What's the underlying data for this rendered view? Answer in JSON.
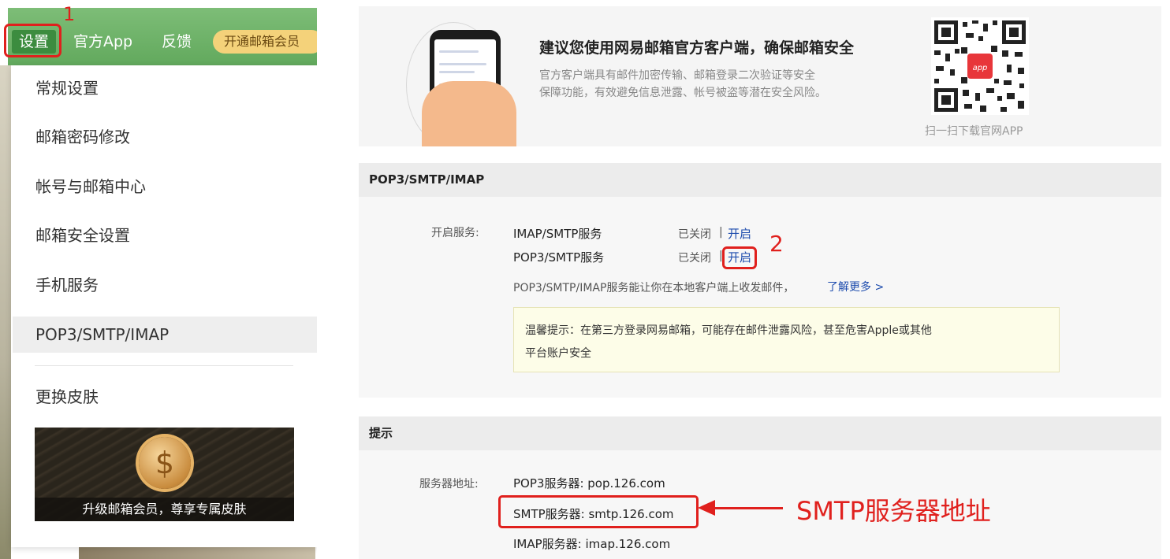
{
  "step_markers": {
    "one": "1",
    "two": "2"
  },
  "topbar": {
    "settings": "设置",
    "official_app": "官方App",
    "feedback": "反馈",
    "vip": "开通邮箱会员"
  },
  "menu": {
    "items": [
      "常规设置",
      "邮箱密码修改",
      "帐号与邮箱中心",
      "邮箱安全设置",
      "手机服务",
      "POP3/SMTP/IMAP",
      "更换皮肤"
    ],
    "active_index": 5,
    "banner_caption": "升级邮箱会员，尊享专属皮肤"
  },
  "promo": {
    "title": "建议您使用网易邮箱官方客户端，确保邮箱安全",
    "desc_line1": "官方客户端具有邮件加密传输、邮箱登录二次验证等安全",
    "desc_line2": "保障功能，有效避免信息泄露、帐号被盗等潜在安全风险。",
    "qr_caption": "扫一扫下载官网APP",
    "qr_badge": "app"
  },
  "pop_panel": {
    "header": "POP3/SMTP/IMAP",
    "service_label": "开启服务:",
    "services": [
      {
        "name": "IMAP/SMTP服务",
        "status": "已关闭",
        "sep": "|",
        "action": "开启"
      },
      {
        "name": "POP3/SMTP服务",
        "status": "已关闭",
        "sep": "|",
        "action": "开启"
      }
    ],
    "info_text": "POP3/SMTP/IMAP服务能让你在本地客户端上收发邮件，",
    "learn_more": "了解更多 >",
    "warning_line1": "温馨提示：在第三方登录网易邮箱，可能存在邮件泄露风险，甚至危害Apple或其他",
    "warning_line2": "平台账户安全"
  },
  "tip_panel": {
    "header": "提示",
    "server_label": "服务器地址:",
    "pop3": "POP3服务器: pop.126.com",
    "smtp": "SMTP服务器: smtp.126.com",
    "imap": "IMAP服务器: imap.126.com"
  },
  "annotation": {
    "smtp_label": "SMTP服务器地址"
  },
  "colors": {
    "accent_red": "#e0201d",
    "link_blue": "#1c4bad",
    "topbar_green": "#62a95d"
  }
}
